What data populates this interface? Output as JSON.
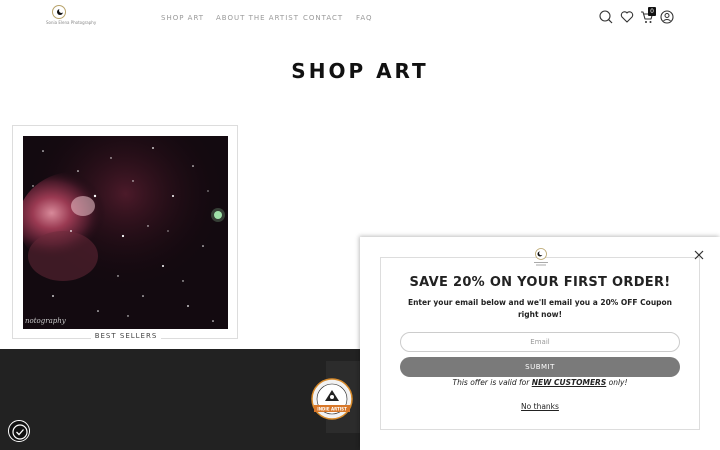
{
  "header": {
    "logo_text": "Sonia Elena Photography",
    "nav": [
      {
        "label": "SHOP ART"
      },
      {
        "label": "ABOUT THE ARTIST"
      },
      {
        "label": "CONTACT"
      },
      {
        "label": "FAQ"
      }
    ],
    "icons": [
      "search-icon",
      "heart-icon",
      "cart-icon",
      "account-icon"
    ],
    "cart_count": "0"
  },
  "main": {
    "title": "SHOP ART",
    "product": {
      "caption": "BEST SELLERS",
      "watermark": "notography"
    }
  },
  "footer": {
    "badge_text": "INDIE ARTIST",
    "accessibility_icon": "accessibility-icon"
  },
  "popup": {
    "heading": "SAVE 20% ON YOUR FIRST ORDER!",
    "subtext": "Enter your email below and we'll email you a 20% OFF Coupon right now!",
    "email_placeholder": "Email",
    "submit_label": "SUBMIT",
    "offer_prefix": "This offer is valid for ",
    "offer_highlight": "NEW CUSTOMERS",
    "offer_suffix": " only!",
    "no_thanks": "No thanks"
  },
  "colors": {
    "footer_bg": "#222222",
    "submit_bg": "#7a7a7a",
    "logo_gold": "#b8a36a"
  }
}
